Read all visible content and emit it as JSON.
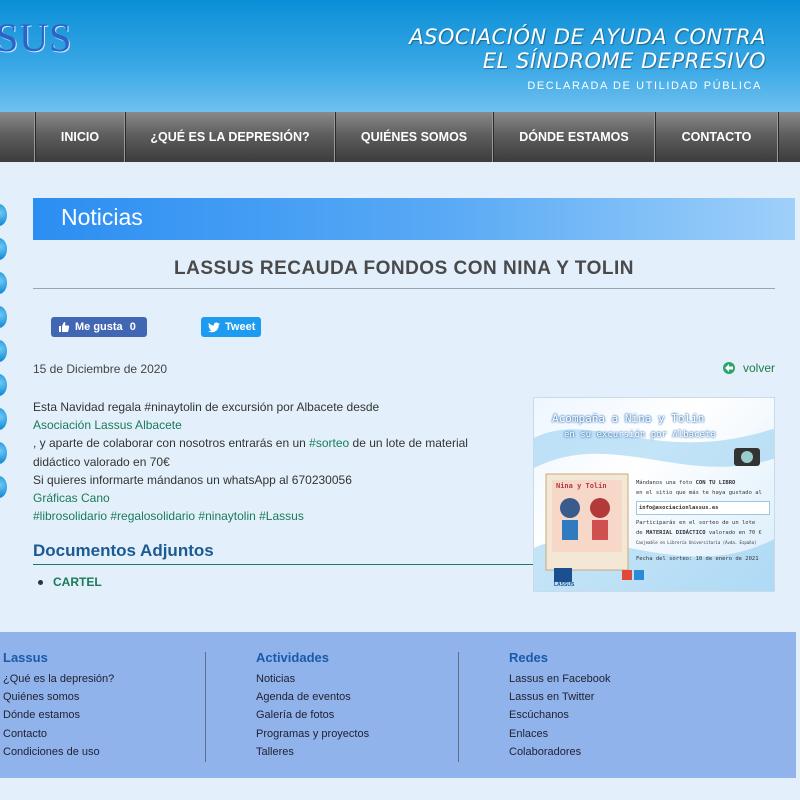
{
  "header": {
    "logo": "SUS",
    "title_line1": "ASOCIACIÓN DE AYUDA CONTRA",
    "title_line2": "EL SÍNDROME DEPRESIVO",
    "subtitle": "DECLARADA DE UTILIDAD PÚBLICA"
  },
  "nav": {
    "items": [
      "INICIO",
      "¿QUÉ ES LA DEPRESIÓN?",
      "QUIÉNES SOMOS",
      "DÓNDE ESTAMOS",
      "CONTACTO"
    ]
  },
  "section": {
    "title": "Noticias"
  },
  "article": {
    "title": "LASSUS RECAUDA FONDOS CON NINA Y TOLIN",
    "like_label": "Me gusta",
    "like_count": "0",
    "tweet_label": "Tweet",
    "date": "15 de Diciembre de 2020",
    "back_label": "volver",
    "line1": "Esta Navidad regala #ninaytolin de excursión por Albacete desde",
    "link_org": "Asociación Lassus Albacete",
    "line3a": ", y aparte de colaborar con nosotros entrarás en un ",
    "link_sorteo": "#sorteo",
    "line3b": " de un lote de material",
    "line4": "didáctico valorado en 70€",
    "line5": "Si quieres informarte mándanos un whatsApp al 670230056",
    "link_graficas": "Gráficas Cano",
    "hashtags": "#librosolidario #regalosolidario #ninaytolin #Lassus"
  },
  "poster": {
    "line1": "Acompaña a Nina y Tolín",
    "line2": "en su excursión por Albacete",
    "line3a": "Mándanos una foto ",
    "line3b": "CON TU LIBRO",
    "line4": "en el sitio que más te haya gustado al",
    "email": "info@asociacionlassus.es",
    "line6": "Participarás en el sorteo de un lote",
    "line7a": "de ",
    "line7b": "MATERIAL DIDÁCTICO",
    "line7c": " valorado en 70 €",
    "line8": "Canjeable en Librería Universitaria (Avda. España)",
    "line9": "Fecha del sorteo: 10 de enero de 2021",
    "book_title": "Nina y Tolín",
    "brand": "LASSUS"
  },
  "documents": {
    "title": "Documentos Adjuntos",
    "items": [
      "CARTEL"
    ]
  },
  "footer": {
    "col1": {
      "title": "Lassus",
      "items": [
        "¿Qué es la depresión?",
        "Quiénes somos",
        "Dónde estamos",
        "Contacto",
        "Condiciones de uso"
      ]
    },
    "col2": {
      "title": "Actividades",
      "items": [
        "Noticias",
        "Agenda de eventos",
        "Galería de fotos",
        "Programas y proyectos",
        "Talleres"
      ]
    },
    "col3": {
      "title": "Redes",
      "items": [
        "Lassus en Facebook",
        "Lassus en Twitter",
        "Escúchanos",
        "Enlaces",
        "Colaboradores"
      ]
    }
  }
}
